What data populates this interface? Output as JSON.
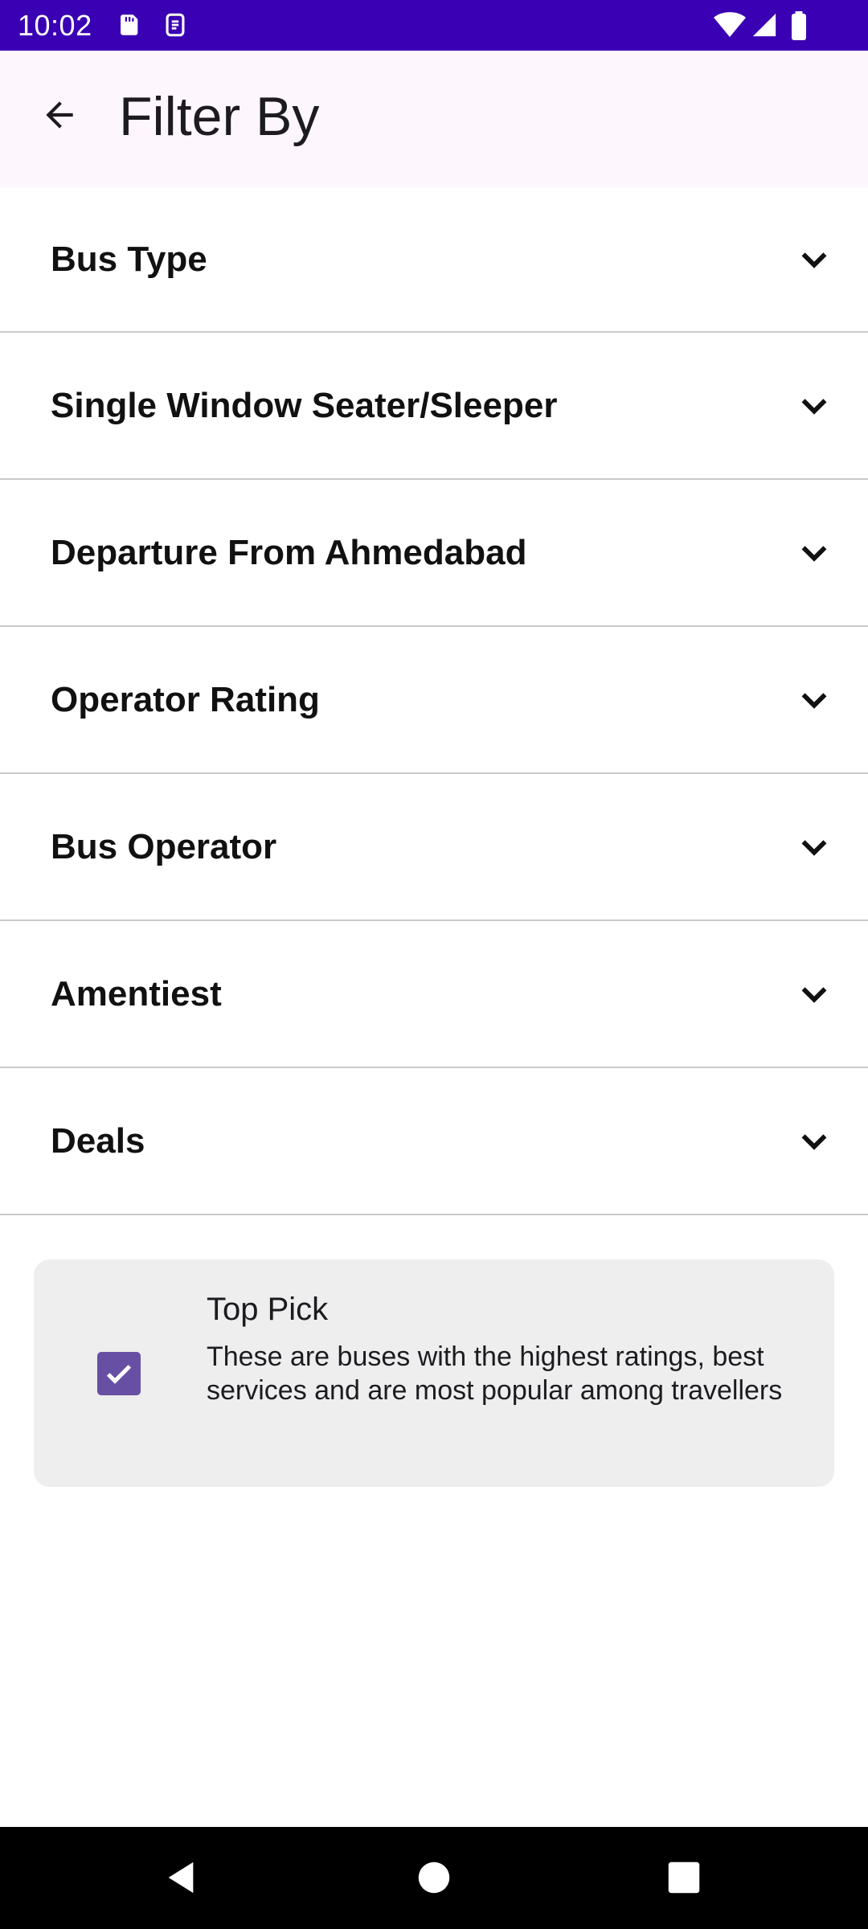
{
  "status_bar": {
    "time": "10:02",
    "left_icons": [
      "sd-card-icon",
      "screen-record-icon"
    ],
    "right_icons": [
      "wifi-icon",
      "signal-icon",
      "battery-icon"
    ],
    "background_color": "#3a00b3"
  },
  "app_bar": {
    "back_icon": "arrow-back-icon",
    "title": "Filter By"
  },
  "filters": [
    {
      "label": "Bus Type"
    },
    {
      "label": "Single Window Seater/Sleeper"
    },
    {
      "label": "Departure From Ahmedabad"
    },
    {
      "label": "Operator Rating"
    },
    {
      "label": "Bus Operator"
    },
    {
      "label": "Amentiest"
    },
    {
      "label": "Deals"
    }
  ],
  "top_pick": {
    "checked": true,
    "title": "Top Pick",
    "description": "These are buses with the highest ratings, best services and are most popular among travellers",
    "accent_color": "#6750a4"
  },
  "nav_bar": {
    "icons": [
      "back-triangle-icon",
      "home-circle-icon",
      "recents-square-icon"
    ]
  }
}
